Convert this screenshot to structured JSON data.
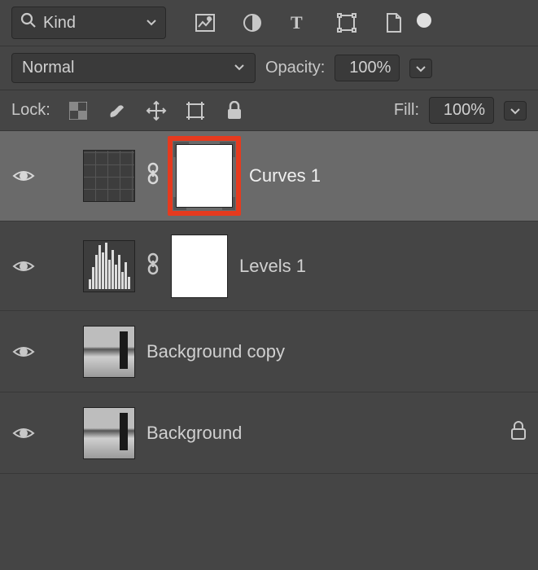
{
  "filter": {
    "mode": "Kind"
  },
  "blend": {
    "mode": "Normal",
    "opacityLabel": "Opacity:",
    "opacityValue": "100%"
  },
  "lock": {
    "label": "Lock:",
    "fillLabel": "Fill:",
    "fillValue": "100%"
  },
  "layers": [
    {
      "name": "Curves 1"
    },
    {
      "name": "Levels 1"
    },
    {
      "name": "Background copy"
    },
    {
      "name": "Background"
    }
  ]
}
